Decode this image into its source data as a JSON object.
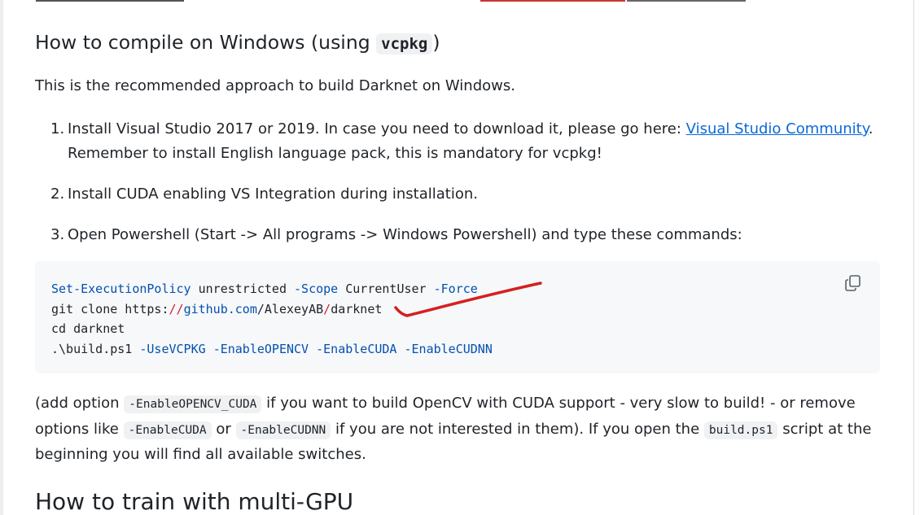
{
  "heading": {
    "prefix": "How to compile on Windows (using",
    "code": "vcpkg",
    "suffix": ")"
  },
  "intro": "This is the recommended approach to build Darknet on Windows.",
  "steps": [
    {
      "num": "1.",
      "text": "Install Visual Studio 2017 or 2019. In case you need to download it, please go here:",
      "link": "Visual Studio Community",
      "after": ".",
      "line2": "Remember to install English language pack, this is mandatory for vcpkg!"
    },
    {
      "num": "2.",
      "text": "Install CUDA enabling VS Integration during installation."
    },
    {
      "num": "3.",
      "text": "Open Powershell (Start -> All programs -> Windows Powershell) and type these commands:"
    }
  ],
  "code": {
    "l1a": "Set-ExecutionPolicy",
    "l1b": " unrestricted ",
    "l1c": "-Scope",
    "l1d": " CurrentUser ",
    "l1e": "-Force",
    "l2a": "git clone https:",
    "l2b": "//",
    "l2c": "github.com",
    "l2d": "/AlexeyAB",
    "l2e": "/",
    "l2f": "darknet",
    "l3": "cd darknet",
    "l4a": ".\\build.ps1 ",
    "l4b": "-UseVCPKG",
    "l4c": " ",
    "l4d": "-EnableOPENCV",
    "l4e": " ",
    "l4f": "-EnableCUDA",
    "l4g": " ",
    "l4h": "-EnableCUDNN"
  },
  "note": {
    "p1": "(add option ",
    "c1": "-EnableOPENCV_CUDA",
    "p2": " if you want to build OpenCV with CUDA support - very slow to build! - or remove",
    "p3": "options like ",
    "c2": "-EnableCUDA",
    "p4": " or ",
    "c3": "-EnableCUDNN",
    "p5": " if you are not interested in them). If you open the ",
    "c4": "build.ps1",
    "p6": " script at the",
    "p7": "beginning you will find all available switches."
  },
  "next_heading": "How to train with multi-GPU",
  "colors": {
    "link": "#0969da",
    "annotation": "#d42020",
    "code_bg": "#f6f8fa"
  },
  "icons": {
    "copy": "copy-icon"
  }
}
